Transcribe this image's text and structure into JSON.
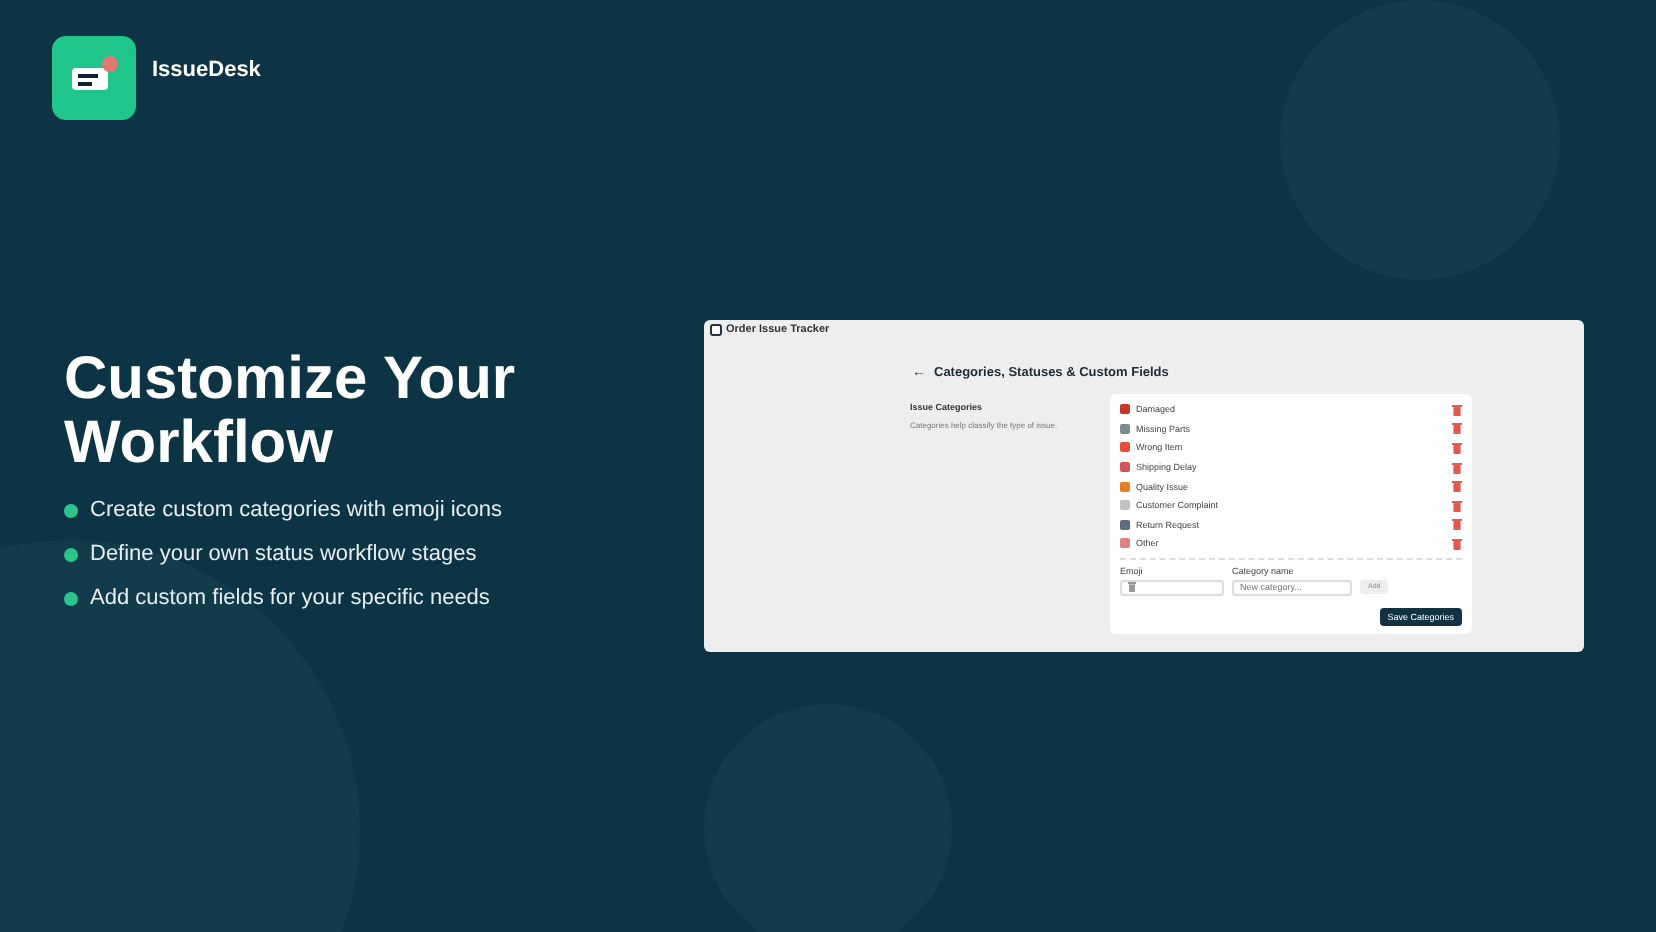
{
  "brand": {
    "name": "IssueDesk"
  },
  "hero": {
    "title": "Customize Your Workflow",
    "bullets": [
      "Create custom categories with emoji icons",
      "Define your own status workflow stages",
      "Add custom fields for your specific needs"
    ]
  },
  "app": {
    "title": "Order Issue Tracker",
    "back": "←",
    "heading": "Categories, Statuses & Custom Fields",
    "section": {
      "title": "Issue Categories",
      "description": "Categories help classify the type of issue."
    },
    "categories": [
      {
        "name": "Damaged",
        "color": "#c0392b"
      },
      {
        "name": "Missing Parts",
        "color": "#7f8c8d"
      },
      {
        "name": "Wrong Item",
        "color": "#e74c3c"
      },
      {
        "name": "Shipping Delay",
        "color": "#d35454"
      },
      {
        "name": "Quality Issue",
        "color": "#e67e22"
      },
      {
        "name": "Customer Complaint",
        "color": "#bdc3c7"
      },
      {
        "name": "Return Request",
        "color": "#5d6d7e"
      },
      {
        "name": "Other",
        "color": "#e08080"
      }
    ],
    "emoji_label": "Emoji",
    "name_label": "Category name",
    "name_placeholder": "New category...",
    "add": "Add",
    "save": "Save Categories"
  }
}
